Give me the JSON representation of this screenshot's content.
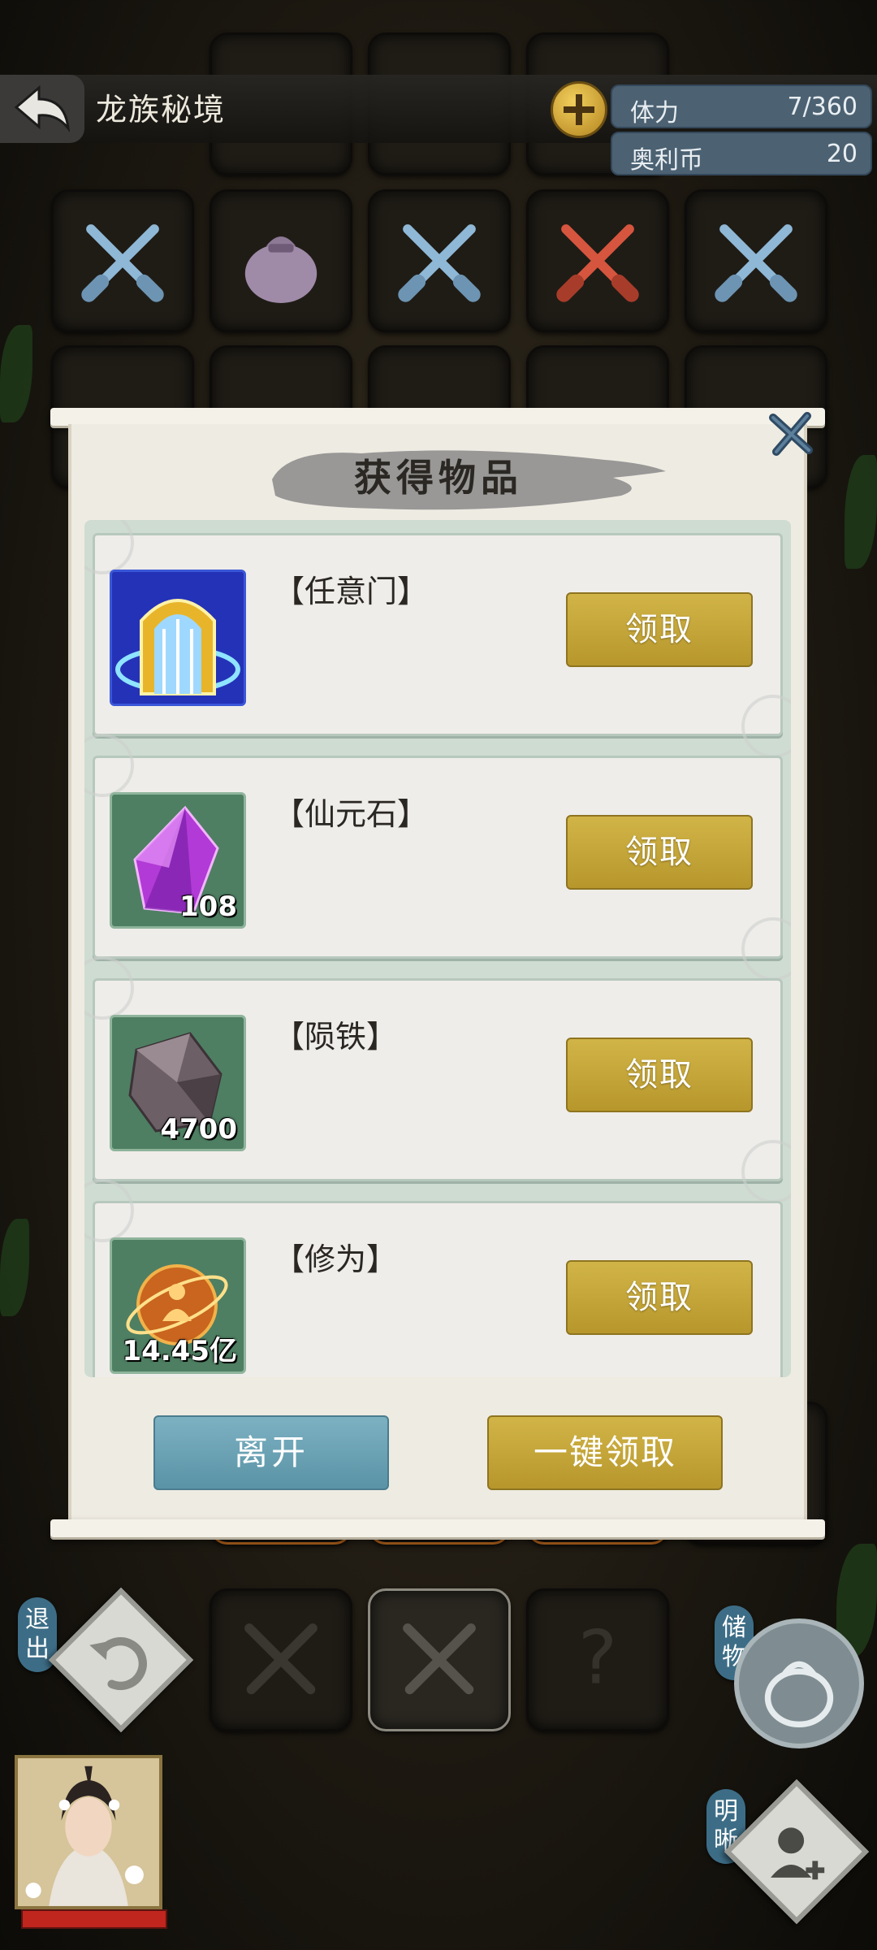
{
  "header": {
    "title": "龙族秘境",
    "stats": [
      {
        "label": "体力",
        "value": "7/360"
      },
      {
        "label": "奥利币",
        "value": "20"
      }
    ]
  },
  "dialog": {
    "title": "获得物品",
    "items": [
      {
        "name": "【任意门】",
        "quantity": "",
        "icon": "golden-door-icon",
        "button": "领取"
      },
      {
        "name": "【仙元石】",
        "quantity": "108",
        "icon": "purple-crystal-icon",
        "button": "领取"
      },
      {
        "name": "【陨铁】",
        "quantity": "4700",
        "icon": "meteorite-ore-icon",
        "button": "领取"
      },
      {
        "name": "【修为】",
        "quantity": "14.45亿",
        "icon": "cultivation-orb-icon",
        "button": "领取"
      }
    ],
    "leave_button": "离开",
    "claim_all_button": "一键领取"
  },
  "controls": {
    "exit_label": "退出",
    "storage_label": "储物",
    "insight_label": "明晰"
  },
  "colors": {
    "claim_gold": "#c4a43a",
    "leave_blue": "#6ba3b5",
    "stat_bg": "#4c6273",
    "hp_red": "#c0261e"
  }
}
